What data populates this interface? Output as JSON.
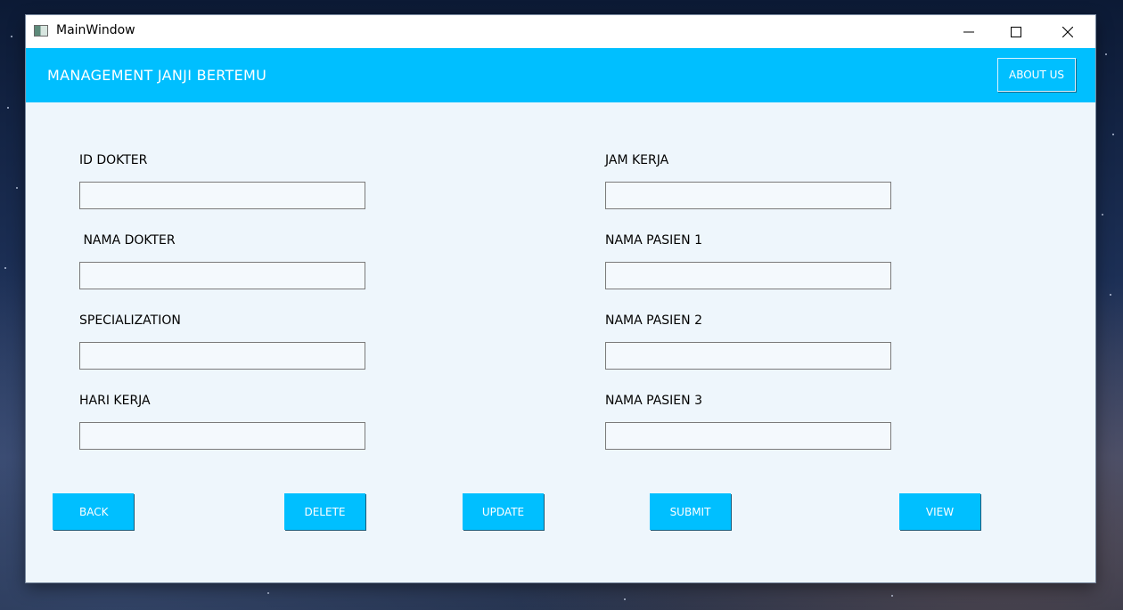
{
  "window": {
    "title": "MainWindow"
  },
  "header": {
    "title": "MANAGEMENT JANJI BERTEMU",
    "about_label": "ABOUT US"
  },
  "form": {
    "left": [
      {
        "label": "ID DOKTER",
        "value": ""
      },
      {
        "label": " NAMA DOKTER",
        "value": ""
      },
      {
        "label": "SPECIALIZATION",
        "value": ""
      },
      {
        "label": "HARI KERJA",
        "value": ""
      }
    ],
    "right": [
      {
        "label": "JAM KERJA",
        "value": ""
      },
      {
        "label": "NAMA PASIEN 1",
        "value": ""
      },
      {
        "label": "NAMA PASIEN 2",
        "value": ""
      },
      {
        "label": "NAMA PASIEN 3",
        "value": ""
      }
    ]
  },
  "actions": {
    "back": "BACK",
    "delete": "DELETE",
    "update": "UPDATE",
    "submit": "SUBMIT",
    "view": "VIEW"
  },
  "colors": {
    "accent": "#00bfff",
    "content_bg": "#eef6fc"
  }
}
